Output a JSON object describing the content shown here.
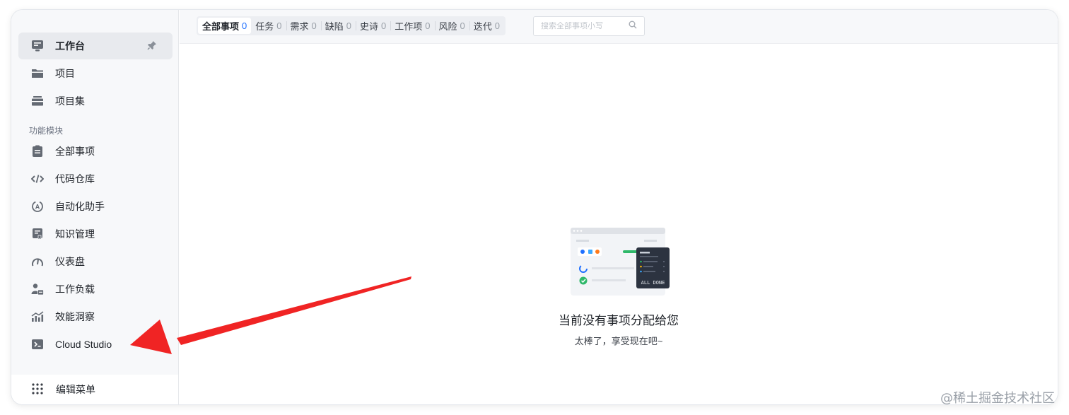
{
  "sidebar": {
    "pinned": [
      {
        "label": "工作台",
        "icon": "monitor-icon",
        "active": true
      },
      {
        "label": "项目",
        "icon": "folder-icon"
      },
      {
        "label": "项目集",
        "icon": "project-set-icon"
      }
    ],
    "section_label": "功能模块",
    "modules": [
      {
        "label": "全部事项",
        "icon": "clipboard-icon"
      },
      {
        "label": "代码仓库",
        "icon": "code-icon"
      },
      {
        "label": "自动化助手",
        "icon": "automation-icon"
      },
      {
        "label": "知识管理",
        "icon": "knowledge-icon"
      },
      {
        "label": "仪表盘",
        "icon": "gauge-icon"
      },
      {
        "label": "工作负载",
        "icon": "workload-icon"
      },
      {
        "label": "效能洞察",
        "icon": "insight-chart-icon"
      },
      {
        "label": "Cloud Studio",
        "icon": "terminal-icon"
      }
    ],
    "bottom_label": "编辑菜单"
  },
  "topbar": {
    "tabs": [
      {
        "label": "全部事项",
        "count": "0"
      },
      {
        "label": "任务",
        "count": "0"
      },
      {
        "label": "需求",
        "count": "0"
      },
      {
        "label": "缺陷",
        "count": "0"
      },
      {
        "label": "史诗",
        "count": "0"
      },
      {
        "label": "工作项",
        "count": "0"
      },
      {
        "label": "风险",
        "count": "0"
      },
      {
        "label": "迭代",
        "count": "0"
      }
    ],
    "search_placeholder": "搜索全部事项小写"
  },
  "empty_state": {
    "title": "当前没有事项分配给您",
    "subtitle": "太棒了，享受现在吧~",
    "illustration_text": "ALL DONE"
  },
  "watermark": "@稀土掘金技术社区",
  "colors": {
    "accent": "#1e6fff",
    "annotation_arrow": "#f02424",
    "done_green": "#2fb86a"
  }
}
